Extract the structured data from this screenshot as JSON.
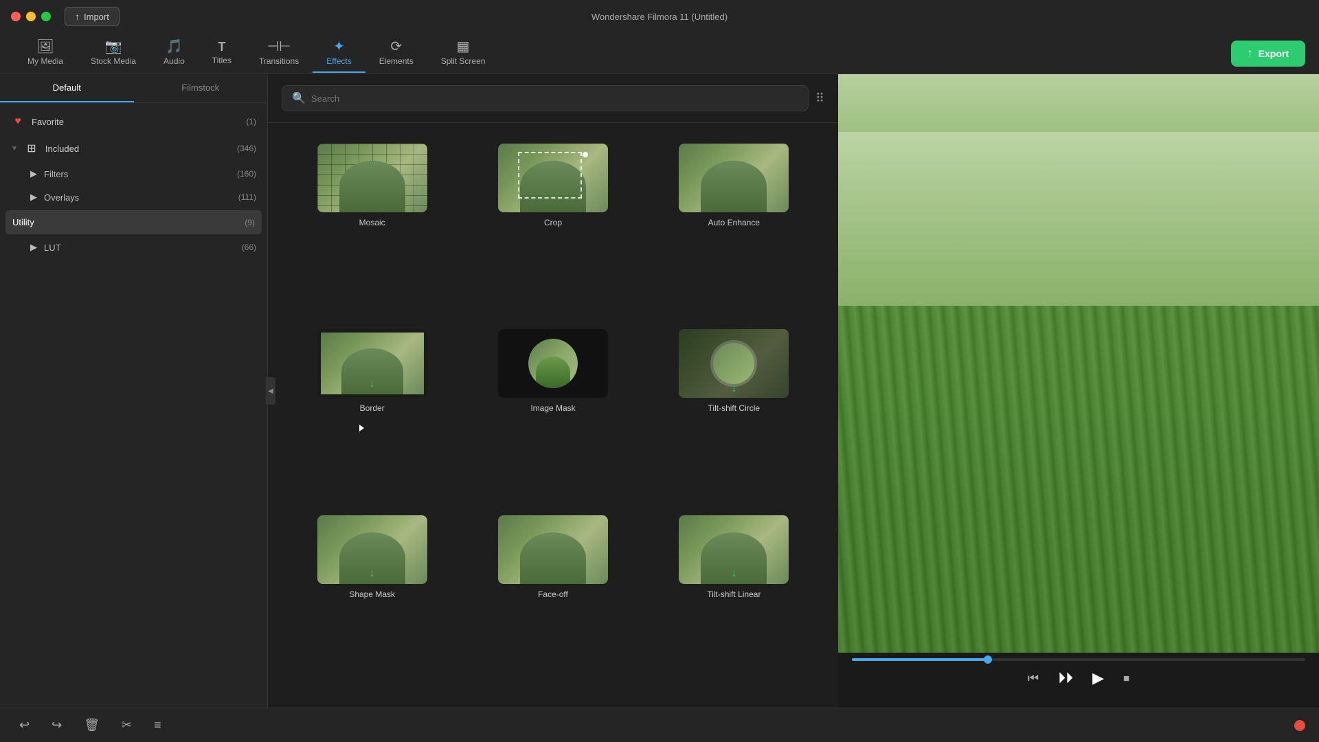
{
  "app": {
    "title": "Wondershare Filmora 11 (Untitled)"
  },
  "titlebar": {
    "import_label": "Import"
  },
  "toolbar": {
    "items": [
      {
        "id": "my-media",
        "icon": "🖼",
        "label": "My Media"
      },
      {
        "id": "stock-media",
        "icon": "📷",
        "label": "Stock Media"
      },
      {
        "id": "audio",
        "icon": "🎵",
        "label": "Audio"
      },
      {
        "id": "titles",
        "icon": "T",
        "label": "Titles"
      },
      {
        "id": "transitions",
        "icon": "⊣⊢",
        "label": "Transitions"
      },
      {
        "id": "effects",
        "icon": "✦",
        "label": "Effects"
      },
      {
        "id": "elements",
        "icon": "⟳",
        "label": "Elements"
      },
      {
        "id": "split-screen",
        "icon": "▦",
        "label": "Split Screen"
      }
    ],
    "export_label": "Export"
  },
  "sidebar": {
    "tabs": [
      {
        "id": "default",
        "label": "Default"
      },
      {
        "id": "filmstock",
        "label": "Filmstock"
      }
    ],
    "menu_items": [
      {
        "id": "favorite",
        "icon": "♥",
        "label": "Favorite",
        "count": "(1)",
        "type": "top"
      },
      {
        "id": "included",
        "icon": "⊞",
        "label": "Included",
        "count": "(346)",
        "type": "parent",
        "expanded": true
      },
      {
        "id": "filters",
        "icon": "",
        "label": "Filters",
        "count": "(160)",
        "type": "child"
      },
      {
        "id": "overlays",
        "icon": "",
        "label": "Overlays",
        "count": "(111)",
        "type": "child"
      },
      {
        "id": "utility",
        "icon": "",
        "label": "Utility",
        "count": "(9)",
        "type": "active"
      },
      {
        "id": "lut",
        "icon": "",
        "label": "LUT",
        "count": "(66)",
        "type": "child"
      }
    ]
  },
  "search": {
    "placeholder": "Search"
  },
  "effects": {
    "items": [
      {
        "id": "mosaic",
        "label": "Mosaic",
        "thumb_type": "mosaic",
        "has_download": false
      },
      {
        "id": "crop",
        "label": "Crop",
        "thumb_type": "crop",
        "has_download": false
      },
      {
        "id": "auto-enhance",
        "label": "Auto Enhance",
        "thumb_type": "auto-enhance",
        "has_download": false
      },
      {
        "id": "border",
        "label": "Border",
        "thumb_type": "border",
        "has_download": true
      },
      {
        "id": "image-mask",
        "label": "Image Mask",
        "thumb_type": "image-mask",
        "has_download": false
      },
      {
        "id": "tilt-shift-circle",
        "label": "Tilt-shift Circle",
        "thumb_type": "tilt-circle",
        "has_download": true
      },
      {
        "id": "shape-mask",
        "label": "Shape Mask",
        "thumb_type": "shape-mask",
        "has_download": true
      },
      {
        "id": "face-off",
        "label": "Face-off",
        "thumb_type": "face-off",
        "has_download": false
      },
      {
        "id": "tilt-shift-linear",
        "label": "Tilt-shift Linear",
        "thumb_type": "tilt-linear",
        "has_download": true
      }
    ]
  },
  "preview": {
    "progress": 30
  },
  "bottom_toolbar": {
    "buttons": [
      "↩",
      "↪",
      "🗑",
      "✂",
      "≡"
    ]
  }
}
